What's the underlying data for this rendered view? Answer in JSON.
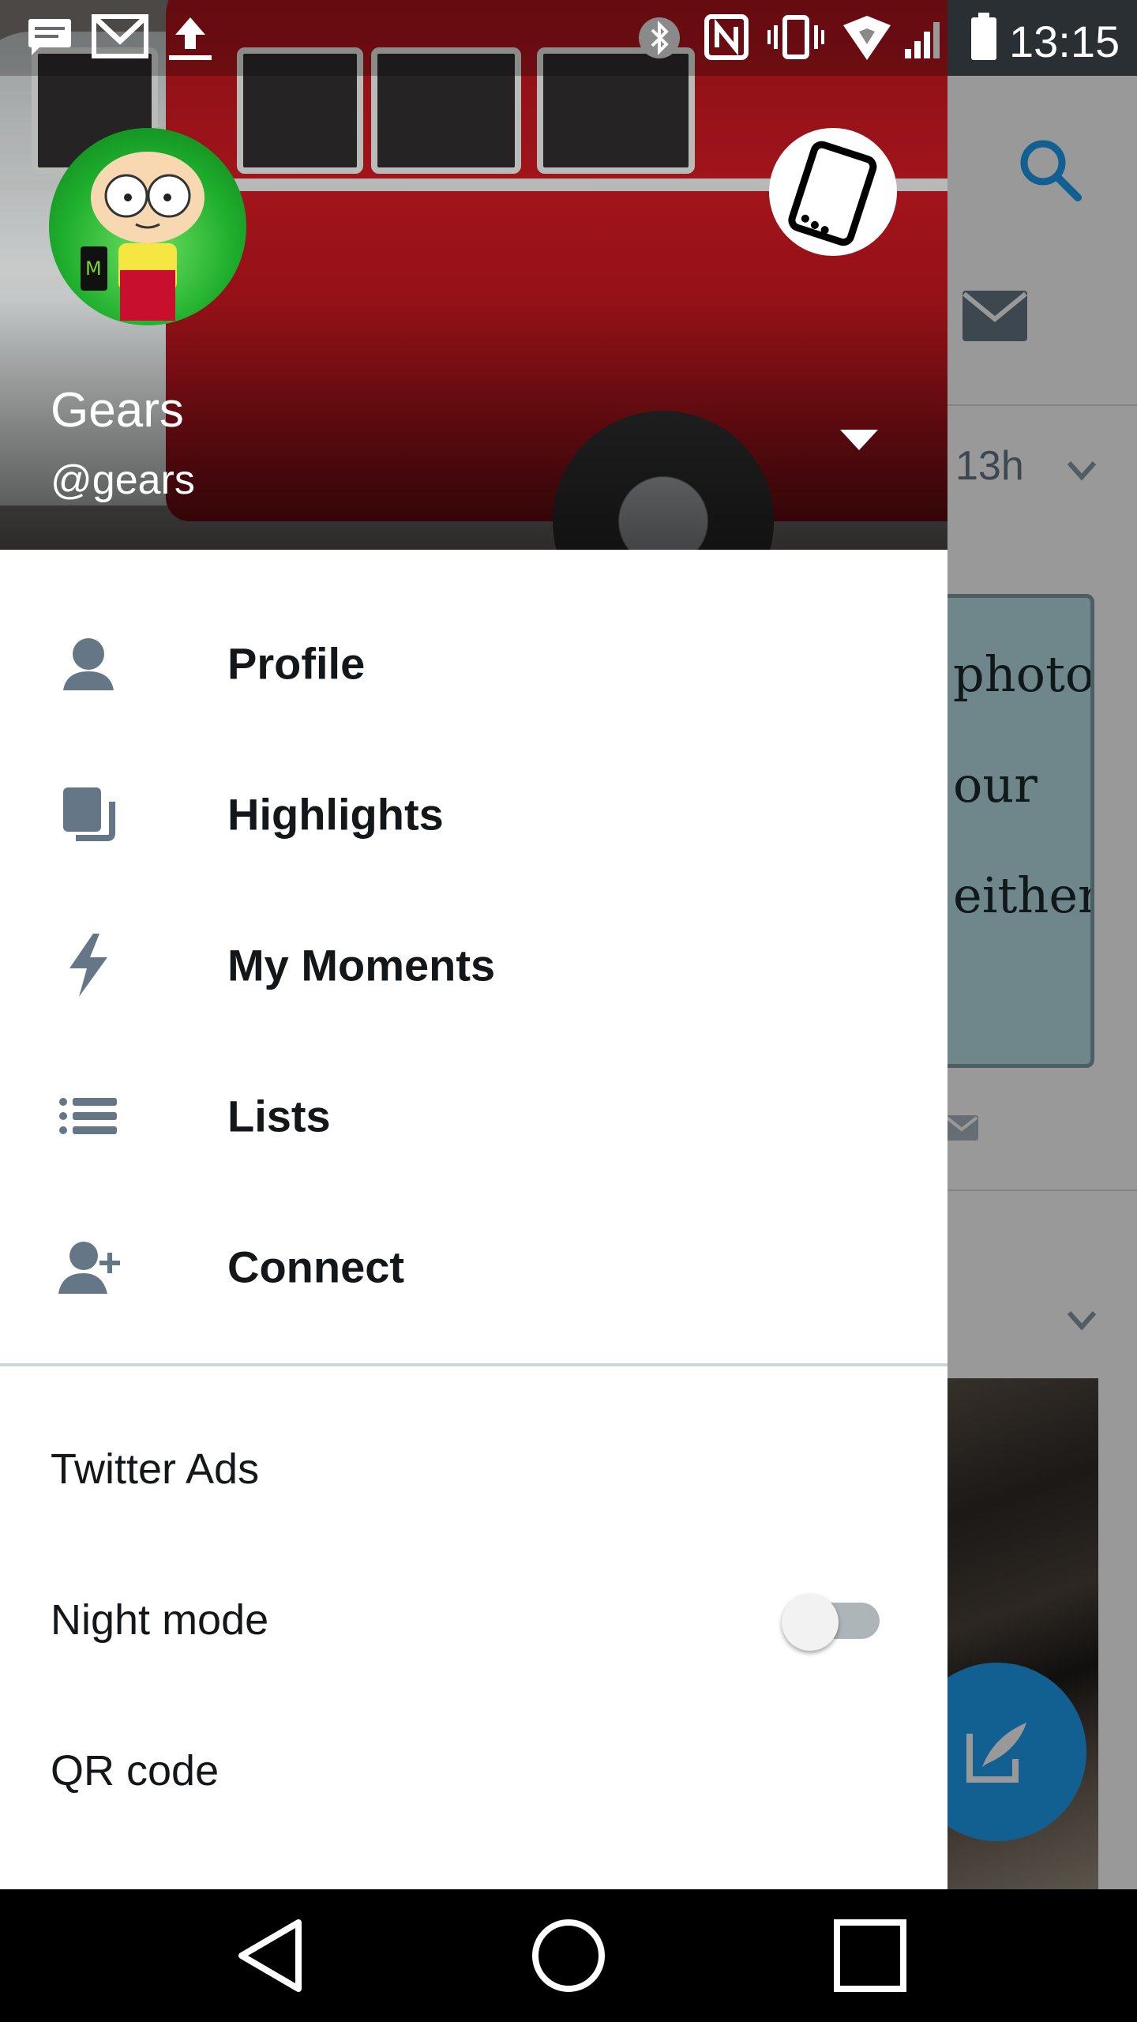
{
  "status_bar": {
    "time": "13:15",
    "left_icons": [
      "message-notification-icon",
      "gmail-icon",
      "upload-icon"
    ],
    "right_icons": [
      "bluetooth-icon",
      "nfc-icon",
      "vibrate-icon",
      "wifi-icon",
      "signal-icon",
      "battery-icon"
    ]
  },
  "drawer": {
    "user": {
      "name": "Gears",
      "handle": "@gears"
    },
    "menu": [
      {
        "label": "Profile",
        "icon": "person-icon"
      },
      {
        "label": "Highlights",
        "icon": "highlights-icon"
      },
      {
        "label": "My Moments",
        "icon": "lightning-icon"
      },
      {
        "label": "Lists",
        "icon": "list-icon"
      },
      {
        "label": "Connect",
        "icon": "add-person-icon"
      }
    ],
    "secondary": [
      {
        "label": "Twitter Ads"
      },
      {
        "label": "Night mode",
        "toggle": false
      },
      {
        "label": "QR code"
      }
    ]
  },
  "background": {
    "tweet_time": "13h",
    "card_text": [
      "photo",
      "our",
      "either."
    ]
  },
  "colors": {
    "accent": "#1da1f2",
    "text_primary": "#14171a",
    "icon_gray": "#657786",
    "divider": "#ccd6dd"
  },
  "nav_bar": {
    "buttons": [
      "back-icon",
      "home-icon",
      "recents-icon"
    ]
  }
}
